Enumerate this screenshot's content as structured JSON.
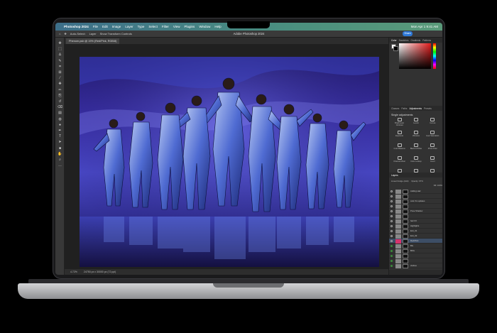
{
  "menubar": {
    "apple": "",
    "items": [
      "Photoshop 2024",
      "File",
      "Edit",
      "Image",
      "Layer",
      "Type",
      "Select",
      "Filter",
      "View",
      "Plugins",
      "Window",
      "Help"
    ],
    "datetime": "Mon Apr 1  9:41 AM"
  },
  "window": {
    "title": "Adobe Photoshop 2024"
  },
  "options_bar": {
    "auto_select": "Auto-Select:",
    "layer": "Layer",
    "show_transform": "Show Transform Controls",
    "share": "Share"
  },
  "document": {
    "tab": "Phenom.psb @ 19% (Red/Pink, RGB/8)",
    "zoom": "4.72%",
    "size": "24750 px x 30000 px (72 ppi)"
  },
  "panels": {
    "color_tabs": [
      "Color",
      "Swatches",
      "Gradients",
      "Patterns"
    ],
    "adj_tabs": [
      "Classes",
      "Paths",
      "Adjustments",
      "Presets"
    ],
    "adj_header": "Single adjustments",
    "adjustments": [
      "Brightness/ Contrast",
      "Levels",
      "Curves",
      "Exposure",
      "Vibrance",
      "Hue/ Saturation",
      "Color Balance",
      "Black & White",
      "Photo Filter",
      "Channel Mixer",
      "Color Lookup",
      "Invert",
      "Posterize",
      "Threshold",
      "Gradient Map"
    ],
    "layers_tabs": [
      "Layers"
    ],
    "layers_controls": {
      "mode": "Linear Dodge (Add)",
      "opacity": "Opacity: 97%",
      "fill": "Fill: 100%"
    },
    "layers": [
      {
        "name": "Adding Hair",
        "green": false,
        "sel": false
      },
      {
        "name": "",
        "green": false,
        "sel": false
      },
      {
        "name": "color fix updates",
        "green": false,
        "sel": false
      },
      {
        "name": "",
        "green": false,
        "sel": false
      },
      {
        "name": "Pose Shadow",
        "green": false,
        "sel": false
      },
      {
        "name": "",
        "green": false,
        "sel": false
      },
      {
        "name": "hair FX",
        "green": false,
        "sel": false
      },
      {
        "name": "Highlights",
        "green": false,
        "sel": false
      },
      {
        "name": "Exit_01",
        "green": false,
        "sel": false
      },
      {
        "name": "Exit_02",
        "green": false,
        "sel": false
      },
      {
        "name": "Red/Pink",
        "green": false,
        "sel": true
      },
      {
        "name": "BG",
        "green": true,
        "sel": false
      },
      {
        "name": "BKG",
        "green": true,
        "sel": false
      },
      {
        "name": "",
        "green": true,
        "sel": false
      },
      {
        "name": "",
        "green": true,
        "sel": false
      },
      {
        "name": "clothes",
        "green": true,
        "sel": false
      }
    ]
  },
  "tools": [
    "move-icon",
    "marquee-icon",
    "lasso-icon",
    "quick-select-icon",
    "crop-icon",
    "frame-icon",
    "eyedropper-icon",
    "healing-icon",
    "brush-icon",
    "clone-stamp-icon",
    "history-brush-icon",
    "eraser-icon",
    "gradient-icon",
    "blur-icon",
    "dodge-icon",
    "pen-icon",
    "type-icon",
    "path-select-icon",
    "shape-icon",
    "hand-icon",
    "zoom-icon",
    "more-icon"
  ],
  "colors": {
    "menubar_a": "#3d6f8a",
    "menubar_b": "#5a9a7a",
    "bg_photo": "#3a2fa8",
    "accent": "#2d78d6"
  }
}
